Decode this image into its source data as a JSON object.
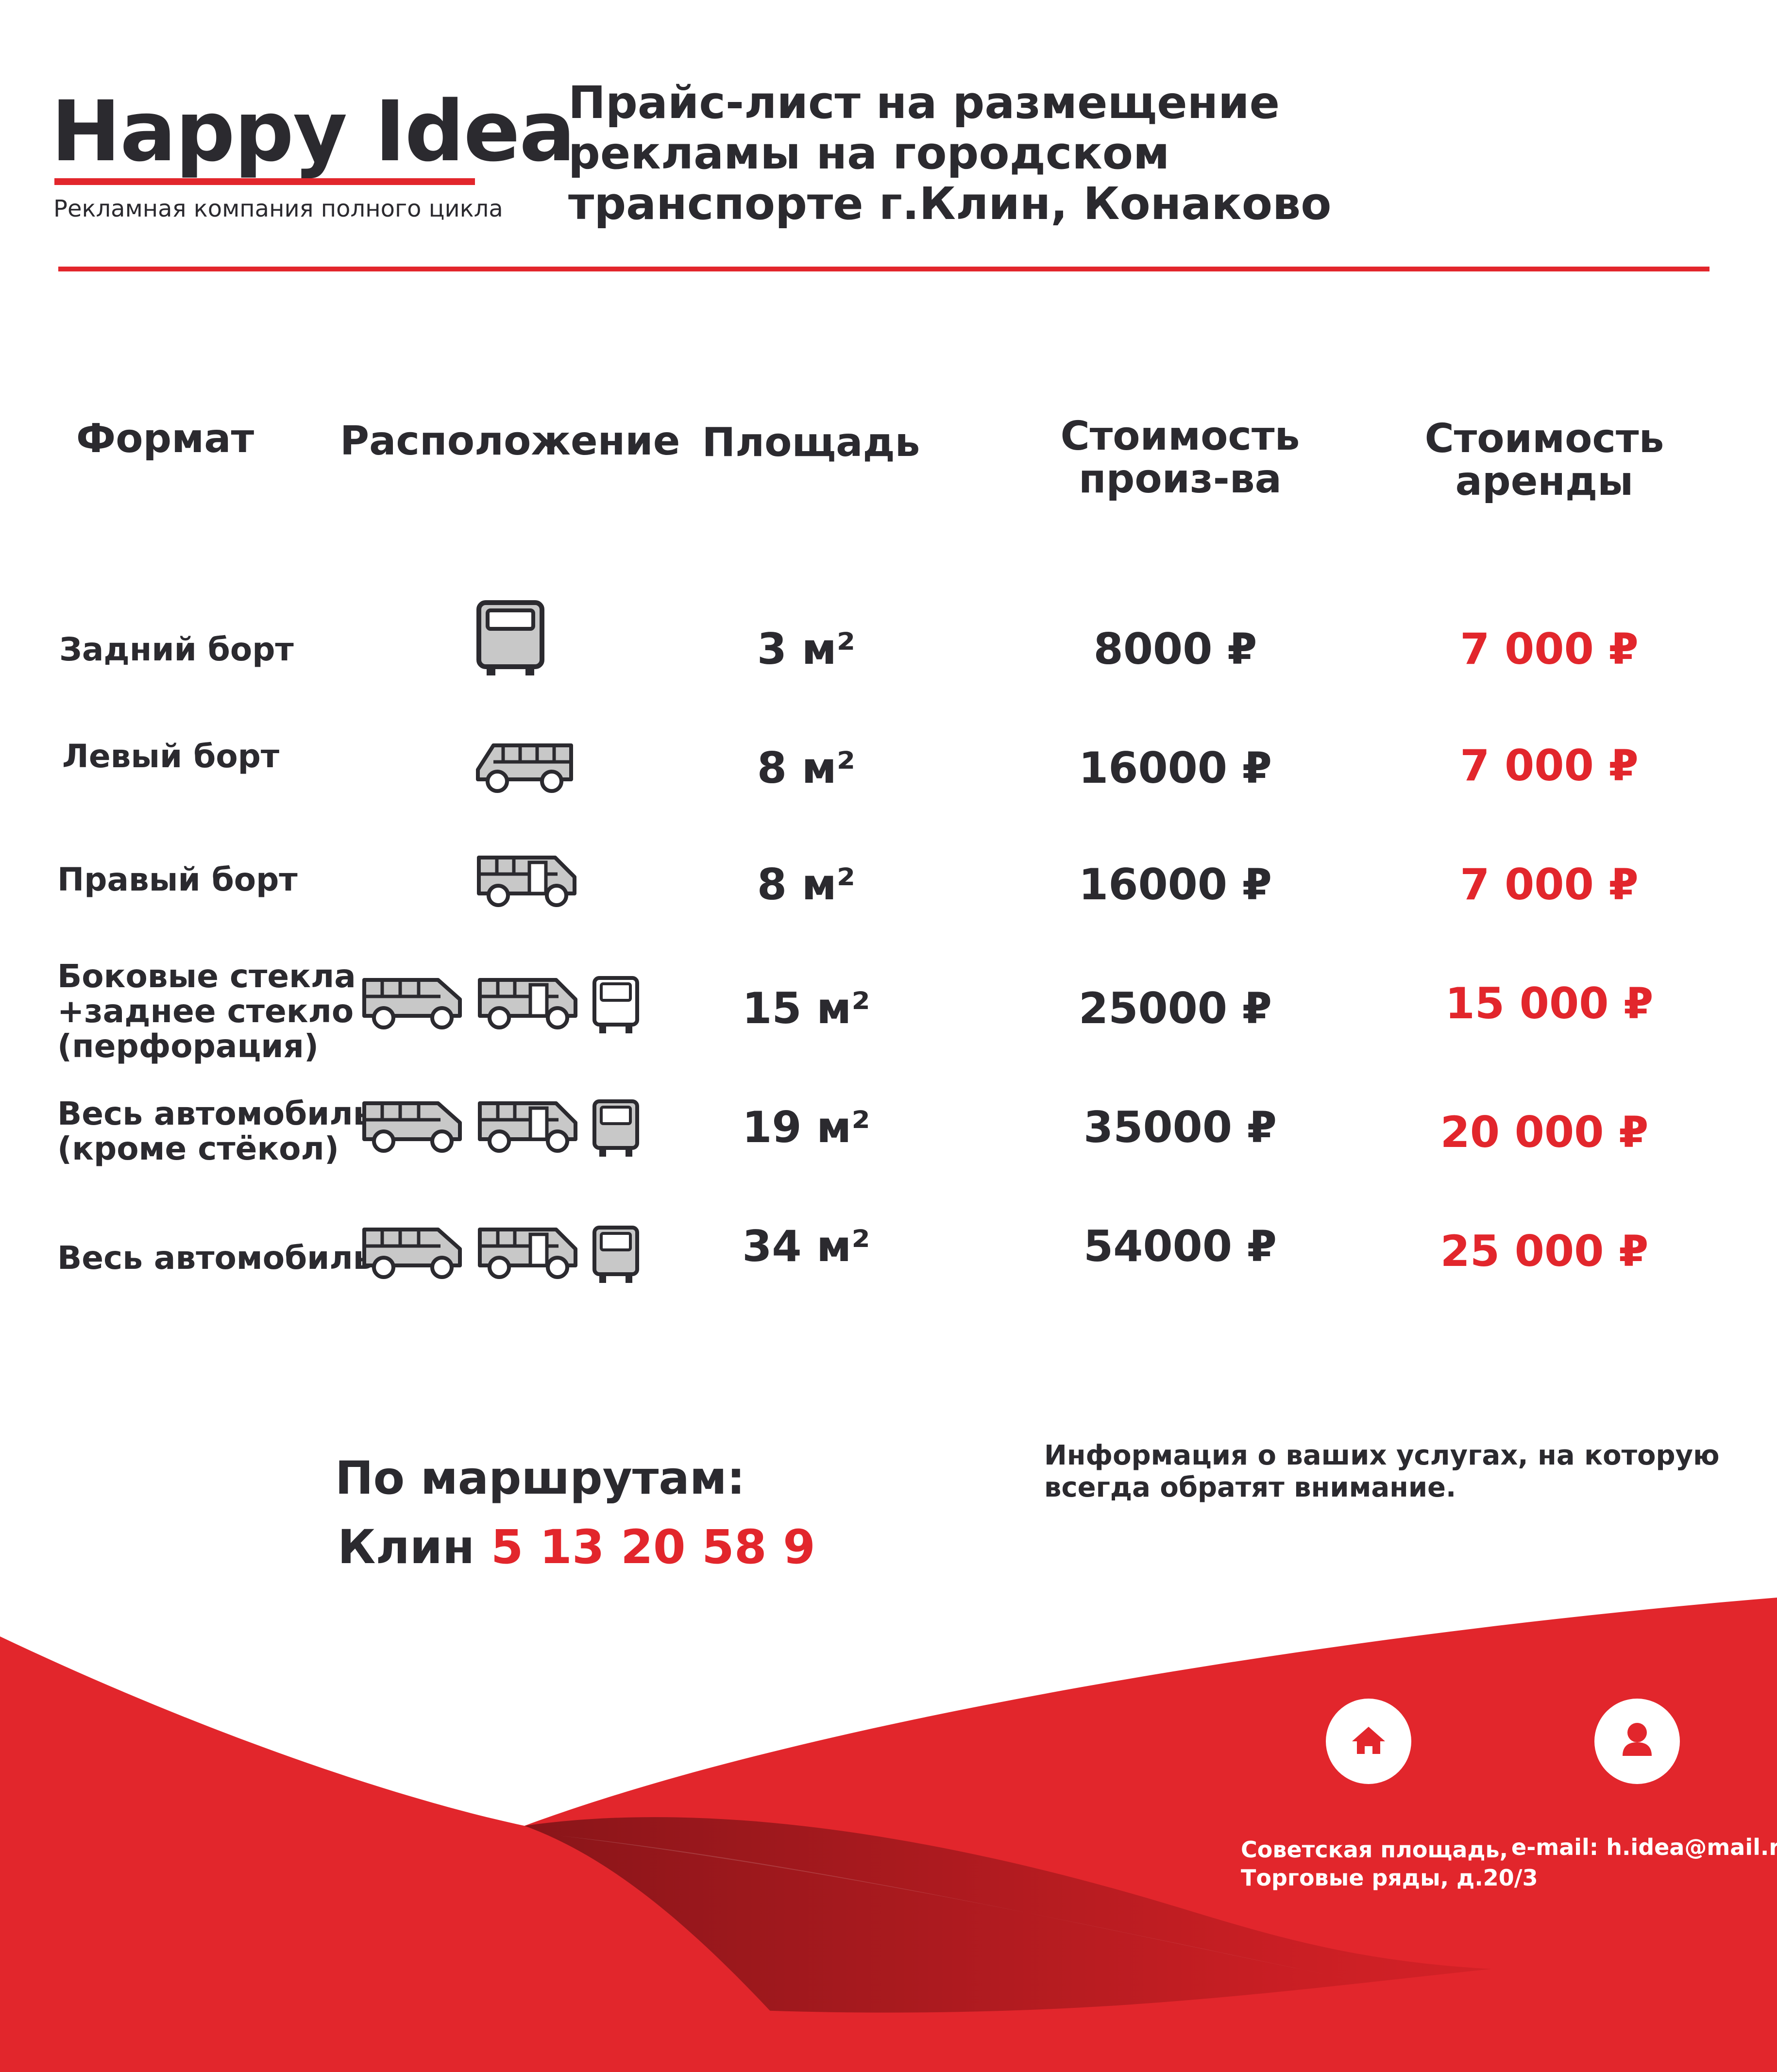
{
  "header": {
    "brand": "Happy Idea",
    "tagline": "Рекламная компания полного цикла",
    "title_lines": [
      "Прайс-лист на размещение",
      "рекламы на городском",
      "транспорте г.Клин, Конаково"
    ]
  },
  "table": {
    "headers": {
      "format": "Формат",
      "location": "Расположение",
      "area": "Площадь",
      "production_1": "Стоимость",
      "production_2": "произ-ва",
      "rent_1": "Стоимость",
      "rent_2": "аренды"
    },
    "rows": [
      {
        "format_lines": [
          "Задний борт"
        ],
        "location_icons": [
          "bus-rear-icon"
        ],
        "area": "3 м²",
        "production": "8000 ₽",
        "rent": "7 000 ₽"
      },
      {
        "format_lines": [
          "Левый борт"
        ],
        "location_icons": [
          "bus-left-side-icon"
        ],
        "area": "8 м²",
        "production": "16000 ₽",
        "rent": "7 000 ₽"
      },
      {
        "format_lines": [
          "Правый борт"
        ],
        "location_icons": [
          "bus-right-side-icon"
        ],
        "area": "8 м²",
        "production": "16000 ₽",
        "rent": "7 000 ₽"
      },
      {
        "format_lines": [
          "Боковые стекла",
          "+заднее стекло",
          "(перфорация)"
        ],
        "location_icons": [
          "bus-left-side-icon",
          "bus-right-side-icon",
          "bus-rear-icon"
        ],
        "area": "15 м²",
        "production": "25000 ₽",
        "rent": "15 000 ₽"
      },
      {
        "format_lines": [
          "Весь автомобиль",
          "(кроме стёкол)"
        ],
        "location_icons": [
          "bus-left-side-icon",
          "bus-right-side-icon",
          "bus-rear-icon"
        ],
        "area": "19 м²",
        "production": "35000 ₽",
        "rent": "20 000 ₽"
      },
      {
        "format_lines": [
          "Весь автомобиль"
        ],
        "location_icons": [
          "bus-left-side-icon",
          "bus-right-side-icon",
          "bus-rear-icon"
        ],
        "area": "34 м²",
        "production": "54000 ₽",
        "rent": "25 000 ₽"
      }
    ]
  },
  "routes": {
    "label": "По маршрутам:",
    "city": "Клин",
    "numbers": "5 13 20 58 9"
  },
  "note": "Информация о ваших услугах, на которую всегда обратят внимание.",
  "footer": {
    "address_lines": [
      "Советская площадь,",
      "Торговые ряды, д.20/3"
    ],
    "email": "e-mail: h.idea@mail.ru",
    "icons": [
      "home-icon",
      "person-icon"
    ]
  },
  "colors": {
    "accent": "#e2262c",
    "text": "#2b2a2f",
    "icon_fill": "#c8c8c8"
  }
}
